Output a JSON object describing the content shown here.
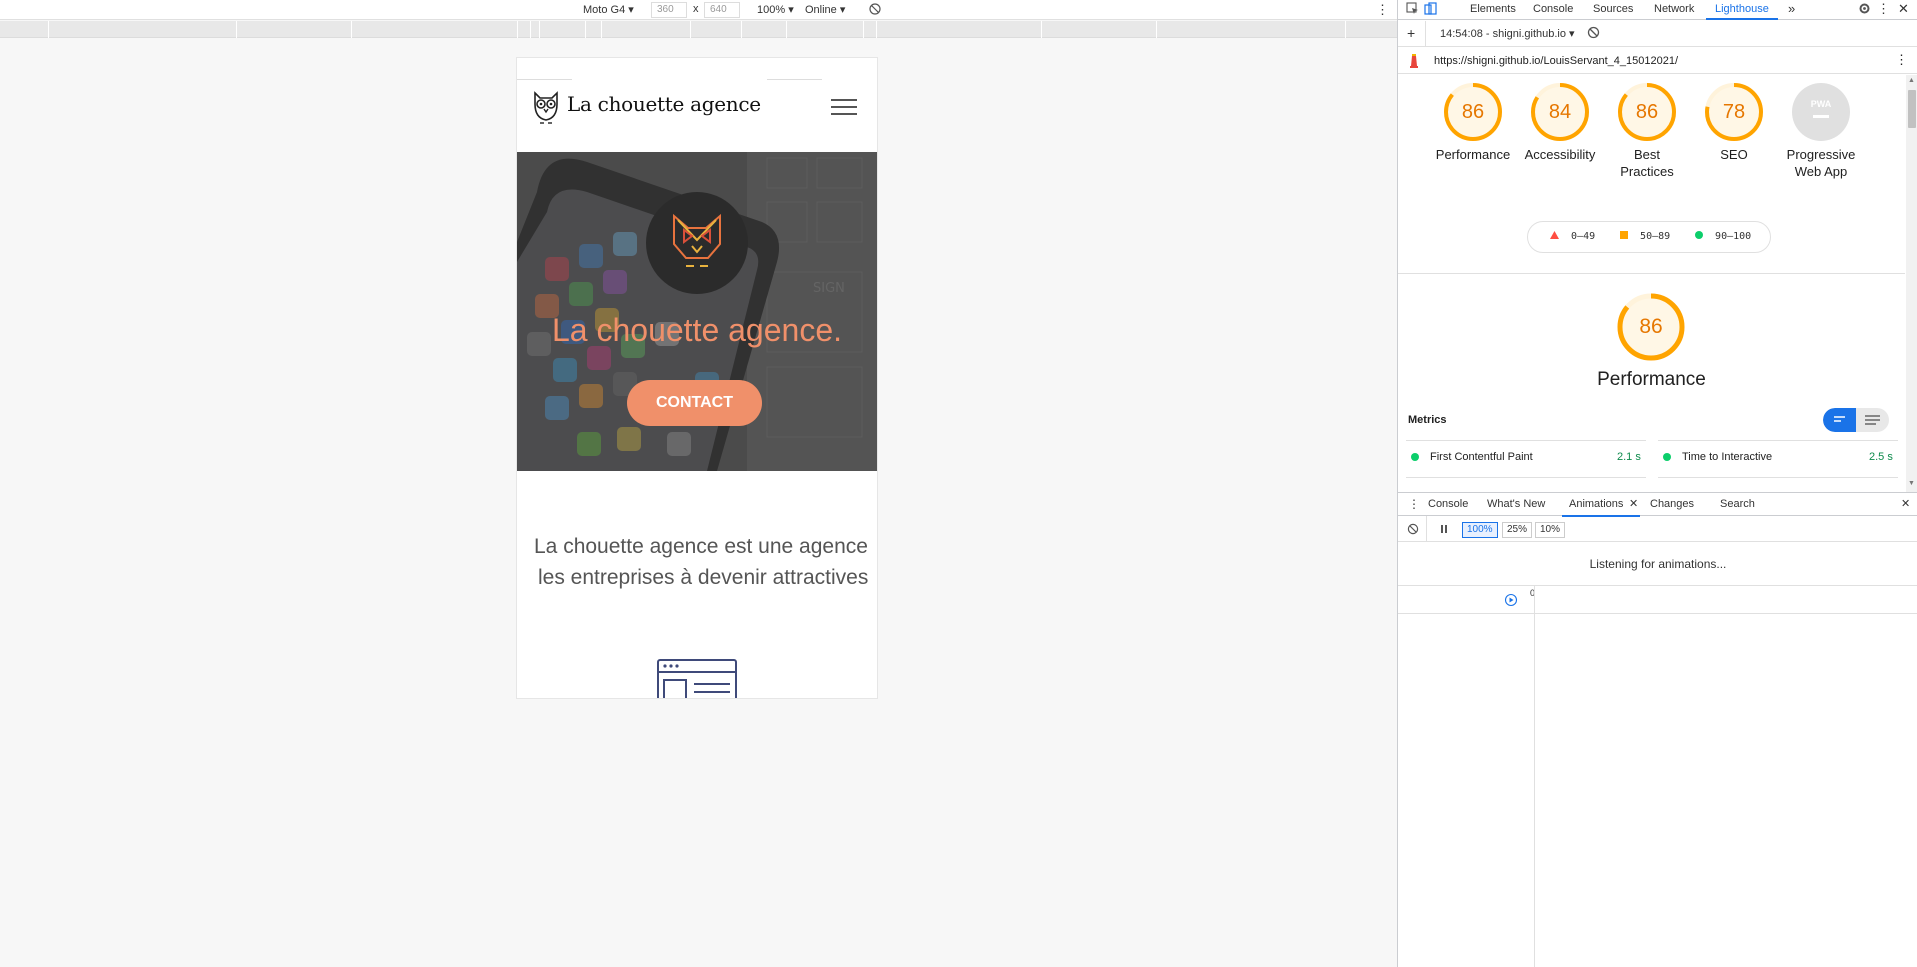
{
  "device_toolbar": {
    "device": "Moto G4",
    "width": "360",
    "x_sep": "x",
    "height": "640",
    "zoom": "100%",
    "network": "Online",
    "more_icon": "vertical-dots-icon",
    "rotate_icon": "rotate-icon"
  },
  "website": {
    "brand": "La chouette agence",
    "hero_title": "La chouette agence.",
    "contact_label": "CONTACT",
    "intro_line1": "La chouette agence est une agence",
    "intro_line2": "les entreprises à devenir attractives",
    "accent_color": "#f0906a"
  },
  "devtools": {
    "tabs": [
      "Elements",
      "Console",
      "Sources",
      "Network",
      "Lighthouse"
    ],
    "active_tab": "Lighthouse",
    "more_tabs": "»",
    "report_selector": "14:54:08 - shigni.github.io",
    "url": "https://shigni.github.io/LouisServant_4_15012021/",
    "categories": [
      {
        "name_l1": "Performance",
        "name_l2": "",
        "score": "86"
      },
      {
        "name_l1": "Accessibility",
        "name_l2": "",
        "score": "84"
      },
      {
        "name_l1": "Best",
        "name_l2": "Practices",
        "score": "86"
      },
      {
        "name_l1": "SEO",
        "name_l2": "",
        "score": "78"
      },
      {
        "name_l1": "Progressive",
        "name_l2": "Web App",
        "score": "PWA"
      }
    ],
    "legend": {
      "fail": "0–49",
      "average": "50–89",
      "pass": "90–100"
    },
    "performance": {
      "score": "86",
      "label": "Performance"
    },
    "metrics_title": "Metrics",
    "metrics": [
      {
        "name": "First Contentful Paint",
        "value": "2.1 s"
      },
      {
        "name": "Time to Interactive",
        "value": "2.5 s"
      }
    ],
    "score_color_average": "#ffa400",
    "score_color_pass": "#0cce6b",
    "score_color_fail": "#ff4e42",
    "drawer": {
      "tabs": [
        "Console",
        "What's New",
        "Animations",
        "Changes",
        "Search"
      ],
      "active_tab": "Animations",
      "rates": [
        "100%",
        "25%",
        "10%"
      ],
      "listening": "Listening for animations...",
      "timeline_zero": "0"
    }
  }
}
